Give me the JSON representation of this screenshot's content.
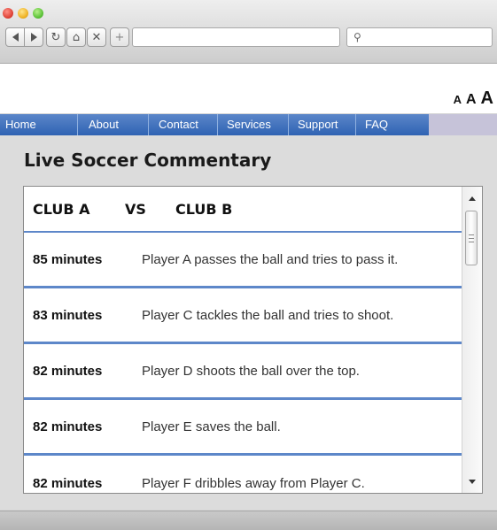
{
  "browser": {
    "url": "",
    "search_icon": "magnifier-icon",
    "new_tab_label": "+"
  },
  "font_sizer": {
    "small": "A",
    "medium": "A",
    "large": "A"
  },
  "nav": {
    "items": [
      {
        "label": "Home"
      },
      {
        "label": "About"
      },
      {
        "label": "Contact"
      },
      {
        "label": "Services"
      },
      {
        "label": "Support"
      },
      {
        "label": "FAQ"
      }
    ]
  },
  "page": {
    "title": "Live Soccer Commentary"
  },
  "match": {
    "club_a": "CLUB A",
    "vs": "VS",
    "club_b": "CLUB B"
  },
  "commentary": [
    {
      "time": "85 minutes",
      "text": "Player A passes the ball and tries to pass it."
    },
    {
      "time": "83 minutes",
      "text": "Player C tackles the ball and tries to shoot."
    },
    {
      "time": "82 minutes",
      "text": "Player D shoots the ball over the top."
    },
    {
      "time": "82 minutes",
      "text": "Player E saves the ball."
    },
    {
      "time": "82 minutes",
      "text": "Player F dribbles away from Player C."
    }
  ],
  "colors": {
    "menu_blue": "#2f63b3",
    "divider_blue": "#5d87c9",
    "menu_tail": "#c6c3d9"
  }
}
